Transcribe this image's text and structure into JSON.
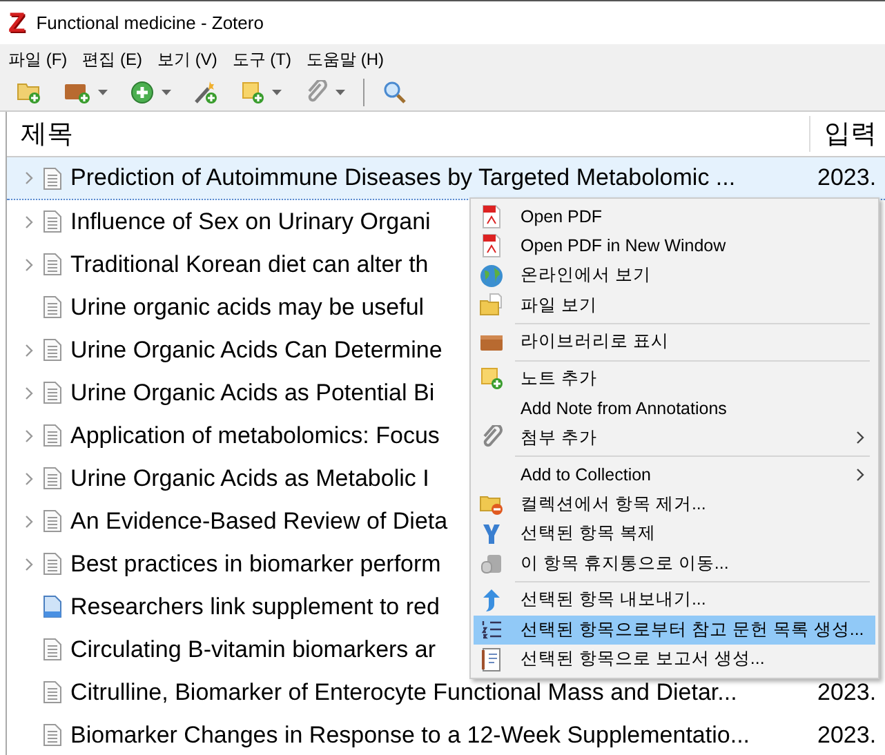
{
  "window": {
    "logo": "Z",
    "title": "Functional medicine - Zotero"
  },
  "menubar": [
    "파일 (F)",
    "편집 (E)",
    "보기 (V)",
    "도구 (T)",
    "도움말 (H)"
  ],
  "table": {
    "columns": [
      "제목",
      "입력"
    ],
    "rows": [
      {
        "title": "Prediction of Autoimmune Diseases by Targeted Metabolomic ...",
        "date": "2023.",
        "has_children": true,
        "kind": "document",
        "selected": true
      },
      {
        "title": "Influence of Sex on Urinary Organi",
        "has_children": true,
        "kind": "document",
        "selected": false
      },
      {
        "title": "Traditional Korean diet can alter th",
        "has_children": true,
        "kind": "document",
        "selected": false
      },
      {
        "title": "Urine organic acids may be useful",
        "has_children": false,
        "kind": "document",
        "selected": false
      },
      {
        "title": "Urine Organic Acids Can Determine",
        "has_children": true,
        "kind": "document",
        "selected": false
      },
      {
        "title": "Urine Organic Acids as Potential Bi",
        "has_children": true,
        "kind": "document",
        "selected": false
      },
      {
        "title": "Application of metabolomics: Focus",
        "has_children": true,
        "kind": "document",
        "selected": false
      },
      {
        "title": "Urine Organic Acids as Metabolic I",
        "has_children": true,
        "kind": "document",
        "selected": false
      },
      {
        "title": "An Evidence-Based Review of Dieta",
        "has_children": true,
        "kind": "document",
        "selected": false
      },
      {
        "title": "Best practices in biomarker perform",
        "has_children": true,
        "kind": "document",
        "selected": false
      },
      {
        "title": "Researchers link supplement to red",
        "has_children": false,
        "kind": "webpage",
        "selected": false
      },
      {
        "title": "Circulating B-vitamin biomarkers ar",
        "has_children": false,
        "kind": "document",
        "selected": false
      },
      {
        "title": "Citrulline, Biomarker of Enterocyte Functional Mass and Dietar...",
        "date": "2023.",
        "has_children": false,
        "kind": "document",
        "selected": false
      },
      {
        "title": "Biomarker Changes in Response to a 12-Week Supplementatio...",
        "date": "2023.",
        "has_children": false,
        "kind": "document",
        "selected": false
      }
    ]
  },
  "context_menu": {
    "items": [
      {
        "kind": "item",
        "label": "Open PDF",
        "submenu": false,
        "selected": false
      },
      {
        "kind": "item",
        "label": "Open PDF in New Window",
        "submenu": false,
        "selected": false
      },
      {
        "kind": "item",
        "label": "온라인에서 보기",
        "submenu": false,
        "selected": false
      },
      {
        "kind": "item",
        "label": "파일 보기",
        "submenu": false,
        "selected": false
      },
      {
        "kind": "separator"
      },
      {
        "kind": "item",
        "label": "라이브러리로 표시",
        "submenu": false,
        "selected": false
      },
      {
        "kind": "separator"
      },
      {
        "kind": "item",
        "label": "노트 추가",
        "submenu": false,
        "selected": false
      },
      {
        "kind": "item",
        "label": "Add Note from Annotations",
        "submenu": false,
        "selected": false
      },
      {
        "kind": "item",
        "label": "첨부 추가",
        "submenu": true,
        "selected": false
      },
      {
        "kind": "separator"
      },
      {
        "kind": "item",
        "label": "Add to Collection",
        "submenu": true,
        "selected": false
      },
      {
        "kind": "item",
        "label": "컬렉션에서 항목 제거...",
        "submenu": false,
        "selected": false
      },
      {
        "kind": "item",
        "label": "선택된 항목 복제",
        "submenu": false,
        "selected": false
      },
      {
        "kind": "item",
        "label": "이 항목 휴지통으로 이동...",
        "submenu": false,
        "selected": false
      },
      {
        "kind": "separator"
      },
      {
        "kind": "item",
        "label": "선택된 항목 내보내기...",
        "submenu": false,
        "selected": false
      },
      {
        "kind": "item",
        "label": "선택된 항목으로부터 참고 문헌 목록 생성...",
        "submenu": false,
        "selected": true
      },
      {
        "kind": "item",
        "label": "선택된 항목으로 보고서 생성...",
        "submenu": false,
        "selected": false
      }
    ]
  }
}
